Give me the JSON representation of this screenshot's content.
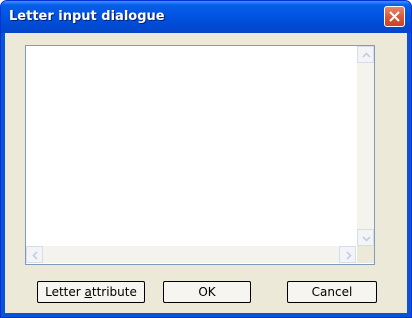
{
  "window": {
    "title": "Letter input dialogue",
    "close_icon": "close-icon"
  },
  "text_area": {
    "value": ""
  },
  "buttons": {
    "letter_attribute": {
      "before": "Letter ",
      "mnemonic": "a",
      "after": "ttribute"
    },
    "ok": "OK",
    "cancel": "Cancel"
  },
  "colors": {
    "titlebar": "#0054e3",
    "close_button": "#d6573a",
    "dialog_bg": "#ece9d8"
  }
}
